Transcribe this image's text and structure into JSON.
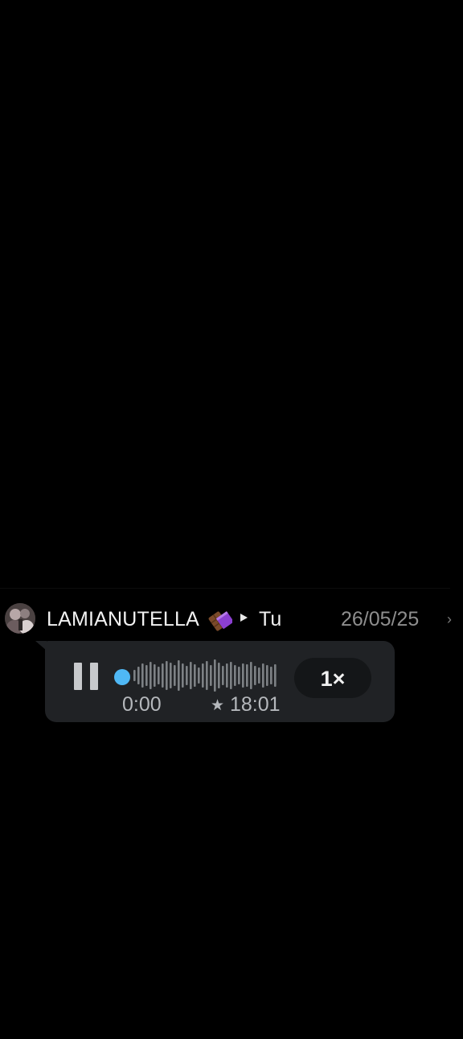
{
  "message": {
    "sender": "LAMIANUTELLA",
    "sender_emoji_icon": "chocolate-bar-icon",
    "recipient": "Tu",
    "date": "26/05/25"
  },
  "voice_note": {
    "current_time": "0:00",
    "total_duration": "18:01",
    "playback_speed": "1×",
    "playback_progress": 0,
    "state": "playing",
    "accent_color": "#4fb8f5",
    "bubble_color": "#202225",
    "waveform_color": "#7d8185"
  }
}
